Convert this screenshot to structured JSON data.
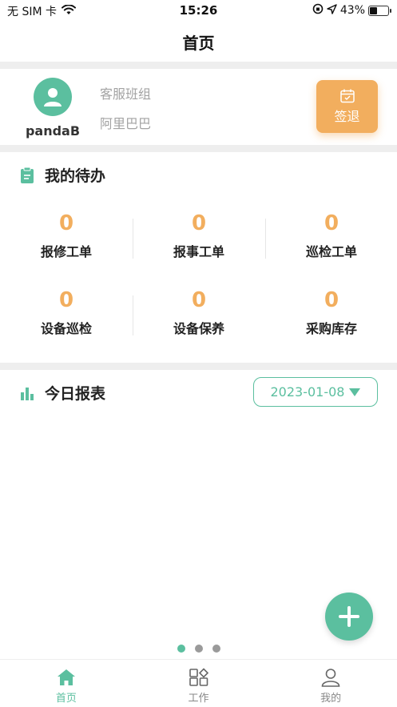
{
  "status_bar": {
    "carrier": "无 SIM 卡",
    "time": "15:26",
    "battery": "43%",
    "battery_level": 0.43
  },
  "nav": {
    "title": "首页"
  },
  "profile": {
    "username": "pandaB",
    "team": "客服班组",
    "company": "阿里巴巴",
    "signout_label": "签退"
  },
  "todo": {
    "title": "我的待办",
    "items": [
      {
        "count": "0",
        "label": "报修工单"
      },
      {
        "count": "0",
        "label": "报事工单"
      },
      {
        "count": "0",
        "label": "巡检工单"
      },
      {
        "count": "0",
        "label": "设备巡检"
      },
      {
        "count": "0",
        "label": "设备保养"
      },
      {
        "count": "0",
        "label": "采购库存"
      }
    ]
  },
  "report": {
    "title": "今日报表",
    "date": "2023-01-08"
  },
  "pager": {
    "total": 3,
    "active": 0
  },
  "tabbar": {
    "tabs": [
      {
        "label": "首页",
        "icon": "home-icon",
        "active": true
      },
      {
        "label": "工作",
        "icon": "apps-icon",
        "active": false
      },
      {
        "label": "我的",
        "icon": "person-icon",
        "active": false
      }
    ]
  },
  "colors": {
    "accent": "#5bbf9f",
    "orange": "#f2ae5e",
    "divider": "#eeeeee"
  }
}
